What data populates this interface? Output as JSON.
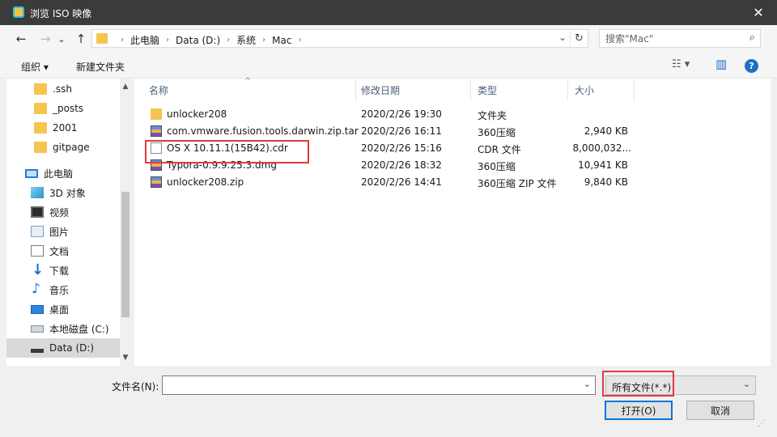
{
  "window": {
    "title": "浏览 ISO 映像",
    "close_glyph": "✕"
  },
  "nav_buttons": {
    "back": "←",
    "forward": "→",
    "recent": "⌄",
    "up": "↑"
  },
  "address": {
    "crumbs": [
      "此电脑",
      "Data (D:)",
      "系统",
      "Mac"
    ],
    "separator": "›",
    "dropdown_glyph": "⌄",
    "refresh_glyph": "↻"
  },
  "search": {
    "placeholder": "搜索\"Mac\"",
    "icon_glyph": "⌕"
  },
  "toolbar": {
    "organize_label": "组织 ▾",
    "new_folder_label": "新建文件夹",
    "view_glyph": "☷ ▾",
    "pane_glyph": "▥",
    "help_glyph": "?"
  },
  "nav_pane": {
    "items": [
      {
        "label": ".ssh",
        "icon": "folder-icon"
      },
      {
        "label": "_posts",
        "icon": "folder-icon"
      },
      {
        "label": "2001",
        "icon": "folder-icon"
      },
      {
        "label": "gitpage",
        "icon": "folder-icon"
      },
      {
        "label": "此电脑",
        "icon": "computer-icon"
      },
      {
        "label": "3D 对象",
        "icon": "3d-objects-icon"
      },
      {
        "label": "视频",
        "icon": "video-icon"
      },
      {
        "label": "图片",
        "icon": "pictures-icon"
      },
      {
        "label": "文档",
        "icon": "documents-icon"
      },
      {
        "label": "下载",
        "icon": "downloads-icon"
      },
      {
        "label": "音乐",
        "icon": "music-icon"
      },
      {
        "label": "桌面",
        "icon": "desktop-icon"
      },
      {
        "label": "本地磁盘 (C:)",
        "icon": "local-disk-icon"
      },
      {
        "label": "Data (D:)",
        "icon": "drive-icon",
        "selected": true
      }
    ],
    "scroll_up_glyph": "▲",
    "scroll_down_glyph": "▼"
  },
  "file_list": {
    "columns": [
      "名称",
      "修改日期",
      "类型",
      "大小"
    ],
    "sort_glyph": "^",
    "rows": [
      {
        "name": "unlocker208",
        "modified": "2020/2/26 19:30",
        "type": "文件夹",
        "size": "",
        "icon": "folder-icon"
      },
      {
        "name": "com.vmware.fusion.tools.darwin.zip.tar",
        "modified": "2020/2/26 16:11",
        "type": "360压缩",
        "size": "2,940 KB",
        "icon": "archive-icon"
      },
      {
        "name": "OS X 10.11.1(15B42).cdr",
        "modified": "2020/2/26 15:16",
        "type": "CDR 文件",
        "size": "8,000,032...",
        "icon": "file-icon"
      },
      {
        "name": "Typora-0.9.9.25.3.dmg",
        "modified": "2020/2/26 18:32",
        "type": "360压缩",
        "size": "10,941 KB",
        "icon": "archive-icon"
      },
      {
        "name": "unlocker208.zip",
        "modified": "2020/2/26 14:41",
        "type": "360压缩 ZIP 文件",
        "size": "9,840 KB",
        "icon": "archive-icon"
      }
    ]
  },
  "bottom": {
    "filename_label": "文件名(N):",
    "filename_value": "",
    "filetype_value": "所有文件(*.*)",
    "chevron": "⌄",
    "open_label": "打开(O)",
    "cancel_label": "取消",
    "grip_glyph": "⋰"
  },
  "colors": {
    "highlight_box": "#e03b3b",
    "accent": "#0078d7"
  }
}
